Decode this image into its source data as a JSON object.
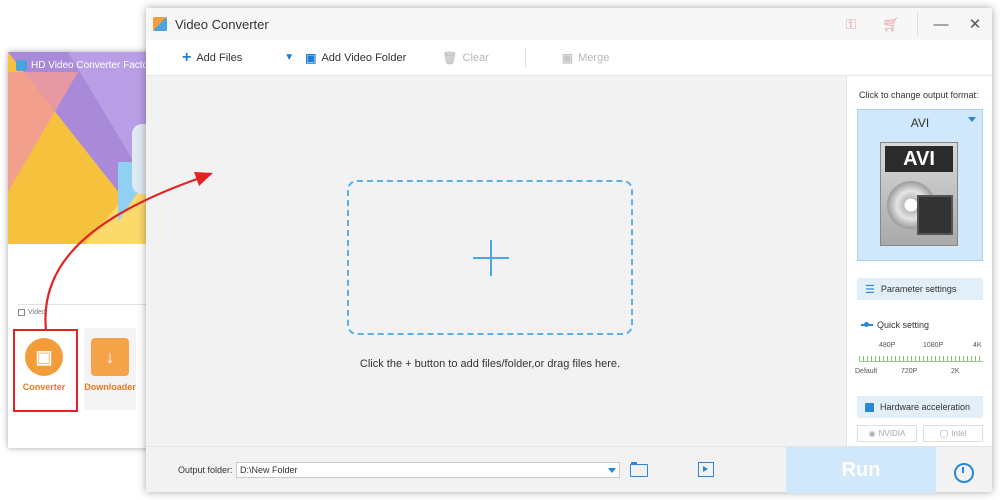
{
  "launcher": {
    "title": "HD Video Converter Factory P",
    "section_video": "Video",
    "tools": [
      {
        "label": "Converter"
      },
      {
        "label": "Downloader"
      }
    ]
  },
  "window": {
    "title": "Video Converter"
  },
  "toolbar": {
    "add_files": "Add Files",
    "add_video_folder": "Add Video Folder",
    "clear": "Clear",
    "merge": "Merge"
  },
  "drop_area": {
    "hint": "Click the + button to add files/folder,or drag files here."
  },
  "right_panel": {
    "header": "Click to change output format:",
    "format": "AVI",
    "format_icon_text": "AVI",
    "parameter_settings": "Parameter settings",
    "quick_setting": "Quick setting",
    "res_top": [
      "480P",
      "1080P",
      "4K"
    ],
    "res_bottom": [
      "Default",
      "720P",
      "2K"
    ],
    "hardware_acceleration": "Hardware acceleration",
    "gpu_nvidia": "NVIDIA",
    "gpu_intel": "Intel"
  },
  "bottom": {
    "output_folder_label": "Output folder:",
    "output_folder_value": "D:\\New Folder",
    "run": "Run"
  },
  "colors": {
    "accent": "#2a86d6",
    "highlight_red": "#e02424",
    "run_disabled": "#d0e8fb"
  }
}
